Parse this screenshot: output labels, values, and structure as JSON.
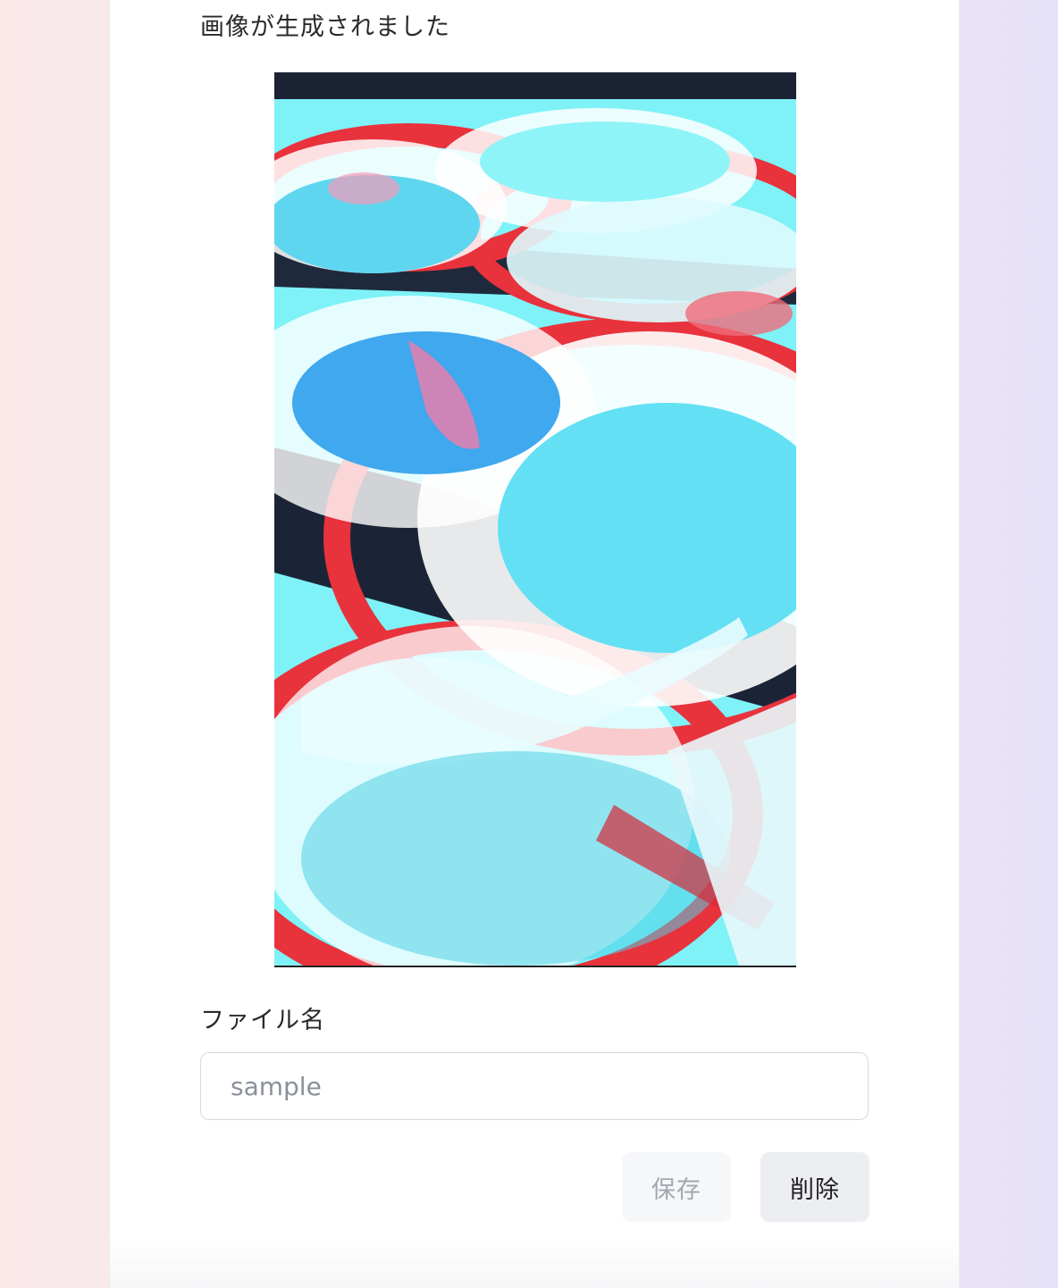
{
  "result": {
    "heading": "画像が生成されました",
    "image_alt": "generated-food-image"
  },
  "form": {
    "filename_label": "ファイル名",
    "filename_value": "",
    "filename_placeholder": "sample"
  },
  "actions": {
    "save_label": "保存",
    "delete_label": "削除"
  },
  "colors": {
    "background_left": "#fbe9ea",
    "background_right": "#e6e2f9",
    "image_cyan": "#6ff0f6",
    "image_red": "#e8323c",
    "save_text_disabled": "#a3a7ae",
    "delete_bg": "#eceef2"
  }
}
